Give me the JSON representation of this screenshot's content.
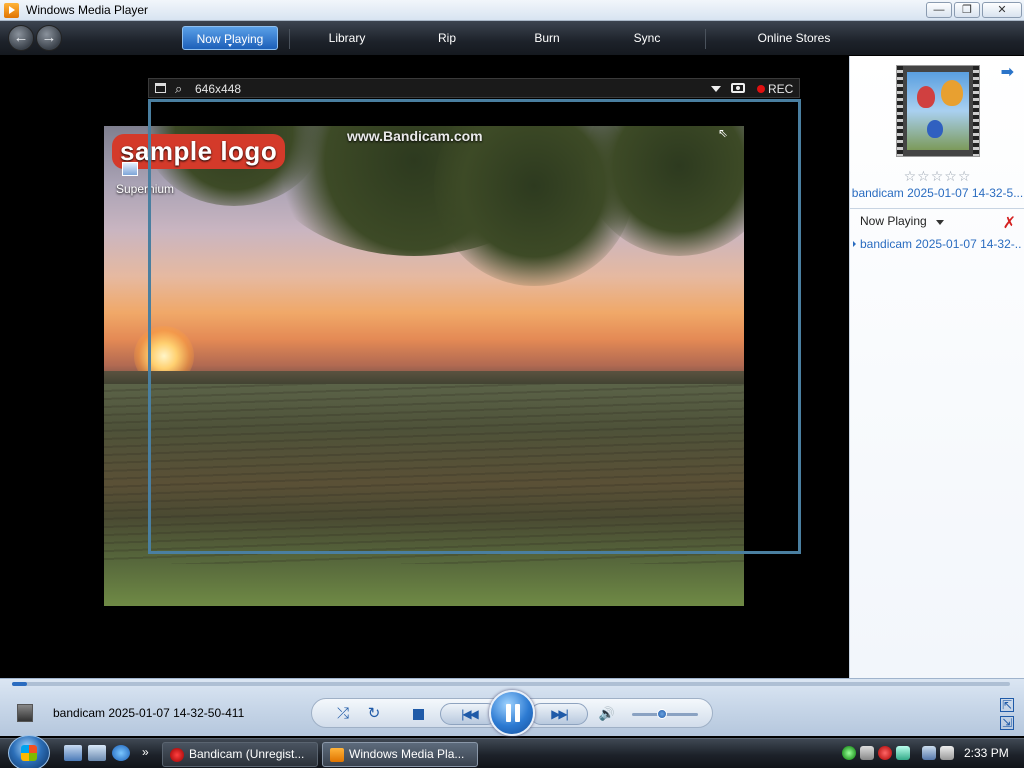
{
  "window": {
    "title": "Windows Media Player",
    "buttons": {
      "minimize": "—",
      "maximize": "❐",
      "close": "✕"
    }
  },
  "nav": {
    "back_glyph": "←",
    "forward_glyph": "→",
    "tabs": [
      {
        "label": "Now Playing",
        "active": true
      },
      {
        "label": "Library",
        "active": false
      },
      {
        "label": "Rip",
        "active": false
      },
      {
        "label": "Burn",
        "active": false
      },
      {
        "label": "Sync",
        "active": false
      },
      {
        "label": "Online Stores",
        "active": false
      }
    ]
  },
  "bandicam": {
    "size": "646x448",
    "rec_label": "REC",
    "rec_color": "#e01010",
    "frame_color": "#4a7fa0",
    "search_glyph": "⌕"
  },
  "video": {
    "logo_text": "sample logo",
    "watermark": "www.Bandicam.com",
    "desktop_icon_label": "Supernium",
    "cursor_glyph": "⇖"
  },
  "sidebar": {
    "arrow_glyph": "➡",
    "rating_stars": "☆☆☆☆☆",
    "media_title": "bandicam 2025-01-07 14-32-5...",
    "now_playing_label": "Now Playing",
    "clear_glyph": "✗",
    "playlist": [
      "bandicam 2025-01-07 14-32-..."
    ]
  },
  "transport": {
    "now_playing_title": "bandicam 2025-01-07 14-32-50-411",
    "shuffle_glyph": "⤮",
    "repeat_glyph": "↻",
    "prev_glyph": "|◀◀",
    "next_glyph": "▶▶|",
    "volume_glyph": "🔊",
    "volume_level": 0.45,
    "seek_progress": 0.015,
    "mini_mode_glyph": "⇱",
    "switch_glyph": "⇲",
    "accent": "#1f5aa8"
  },
  "taskbar": {
    "tasks": [
      {
        "label": "Bandicam (Unregist...",
        "active": false
      },
      {
        "label": "Windows Media Pla...",
        "active": true
      }
    ],
    "more_glyph": "»",
    "clock": "2:33 PM"
  }
}
